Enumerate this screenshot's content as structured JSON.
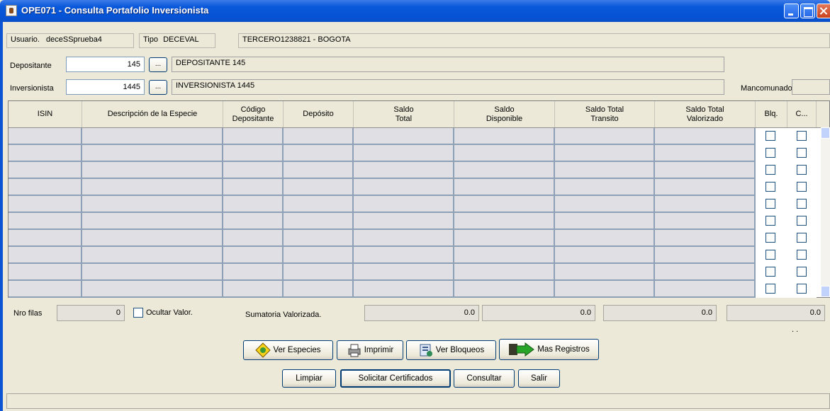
{
  "window": {
    "title": "OPE071 - Consulta Portafolio Inversionista"
  },
  "user_bar": {
    "usuario_label": "Usuario.",
    "usuario_value": "deceSSprueba4",
    "tipo_label": "Tipo",
    "tipo_value": "DECEVAL",
    "tercero_value": "TERCERO1238821 - BOGOTA"
  },
  "depositante": {
    "label": "Depositante",
    "code": "145",
    "button": "...",
    "name": "DEPOSITANTE 145"
  },
  "inversionista": {
    "label": "Inversionista",
    "code": "1445",
    "button": "...",
    "name": "INVERSIONISTA 1445"
  },
  "mancomunado": {
    "label": "Mancomunado",
    "value": ""
  },
  "grid": {
    "columns": [
      "ISIN",
      "Descripción de la Especie",
      "Código\nDepositante",
      "Depósito",
      "Saldo\nTotal",
      "Saldo\nDisponible",
      "Saldo Total\nTransito",
      "Saldo Total\nValorizado",
      "Blq.",
      "C..."
    ],
    "row_count": 10,
    "checked_blq": [
      false,
      false,
      false,
      false,
      false,
      false,
      false,
      false,
      false,
      false
    ],
    "checked_c": [
      false,
      false,
      false,
      false,
      false,
      false,
      false,
      false,
      false,
      false
    ]
  },
  "summary": {
    "nro_filas_label": "Nro filas",
    "nro_filas_value": "0",
    "ocultar_label": "Ocultar Valor.",
    "ocultar_checked": false,
    "sumatoria_label": "Sumatoria Valorizada.",
    "sum1": "0.0",
    "sum2": "0.0",
    "sum3": "0.0",
    "sum4": "0.0",
    "dots": ".     ."
  },
  "buttons": {
    "ver_especies": "Ver Especies",
    "imprimir": "Imprimir",
    "ver_bloqueos": "Ver Bloqueos",
    "mas_registros": "Mas Registros",
    "limpiar": "Limpiar",
    "solicitar": "Solicitar Certificados",
    "consultar": "Consultar",
    "salir": "Salir"
  },
  "status": {
    "text": ""
  }
}
